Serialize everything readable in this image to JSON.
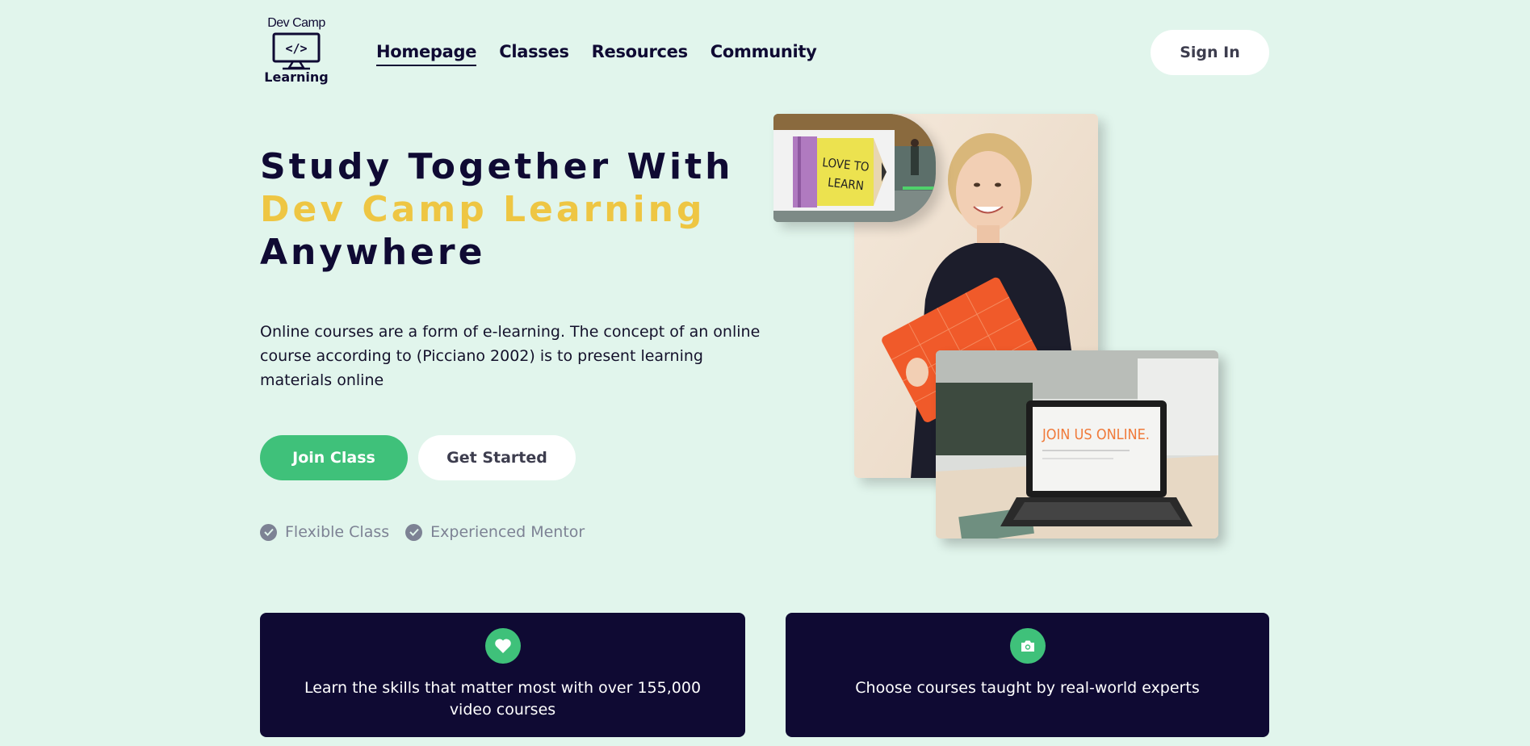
{
  "logo": {
    "top_text": "Dev Camp",
    "bottom_text": "Learning",
    "icon": "monitor-code-icon"
  },
  "nav": {
    "items": [
      {
        "label": "Homepage",
        "active": true
      },
      {
        "label": "Classes",
        "active": false
      },
      {
        "label": "Resources",
        "active": false
      },
      {
        "label": "Community",
        "active": false
      }
    ],
    "sign_in": "Sign In"
  },
  "hero": {
    "title_line1": "Study Together With",
    "title_line2": "Dev Camp Learning",
    "title_line3": "Anywhere",
    "description": "Online courses are a form of e-learning. The concept of an online course according to (Picciano 2002) is to present learning materials online",
    "join_button": "Join Class",
    "start_button": "Get Started",
    "features": [
      {
        "label": "Flexible Class",
        "icon": "check-circle-icon"
      },
      {
        "label": "Experienced Mentor",
        "icon": "check-circle-icon"
      }
    ],
    "images": {
      "pencil_sign_text_1": "LOVE TO",
      "pencil_sign_text_2": "LEARN",
      "laptop_screen_text": "JOIN US ONLINE."
    }
  },
  "cards": [
    {
      "text": "Learn the skills that matter most with over 155,000 video courses",
      "icon": "heart-icon"
    },
    {
      "text": "Choose courses taught by real-world experts",
      "icon": "camera-icon"
    }
  ],
  "colors": {
    "background": "#e1f5ec",
    "navy": "#0f0a33",
    "accent_yellow": "#eec643",
    "green": "#3fc17a",
    "muted_gray": "#7d8294"
  }
}
